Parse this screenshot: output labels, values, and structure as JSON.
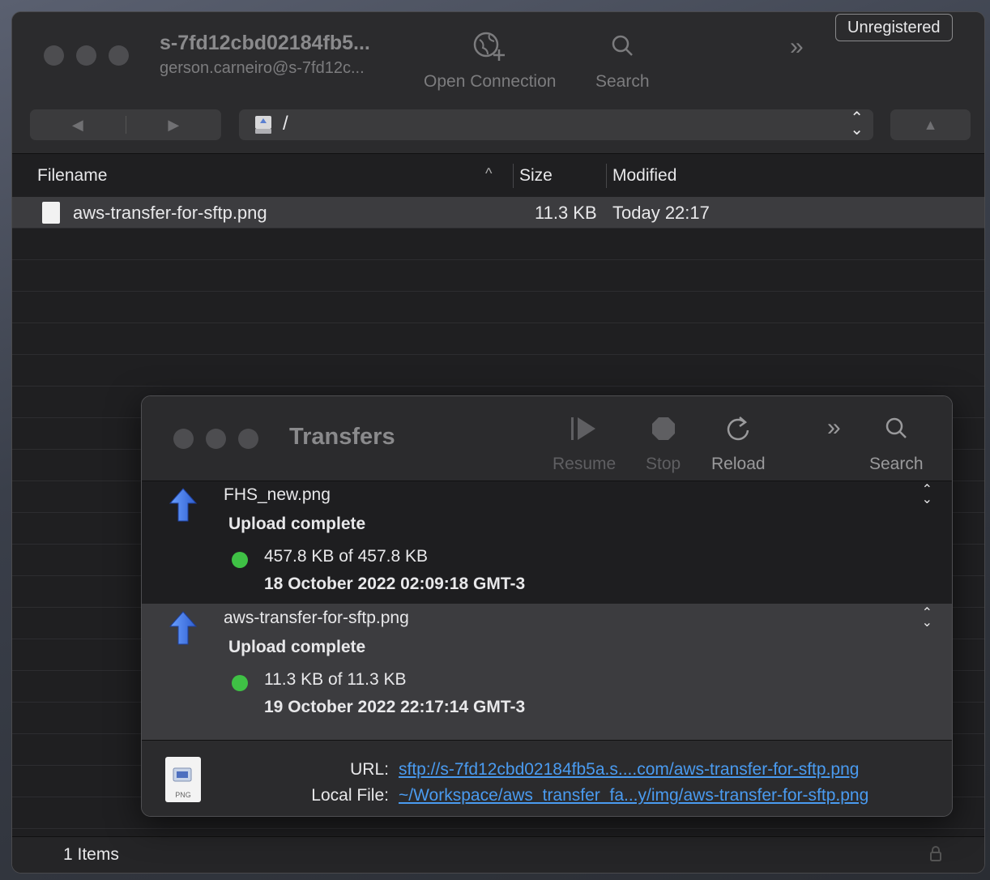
{
  "window": {
    "title": "s-7fd12cbd02184fb5...",
    "subtitle": "gerson.carneiro@s-7fd12c...",
    "unregistered_label": "Unregistered",
    "open_connection_label": "Open Connection",
    "search_label": "Search"
  },
  "nav": {
    "path": "/"
  },
  "columns": {
    "filename": "Filename",
    "size": "Size",
    "modified": "Modified"
  },
  "files": [
    {
      "name": "aws-transfer-for-sftp.png",
      "size": "11.3 KB",
      "modified": "Today 22:17"
    }
  ],
  "status": {
    "items": "1 Items"
  },
  "transfers": {
    "title": "Transfers",
    "resume_label": "Resume",
    "stop_label": "Stop",
    "reload_label": "Reload",
    "search_label": "Search",
    "items": [
      {
        "name": "FHS_new.png",
        "status": "Upload complete",
        "size": "457.8 KB of 457.8 KB",
        "date": "18 October 2022 02:09:18 GMT-3"
      },
      {
        "name": "aws-transfer-for-sftp.png",
        "status": "Upload complete",
        "size": "11.3 KB of 11.3 KB",
        "date": "19 October 2022 22:17:14 GMT-3"
      }
    ],
    "footer": {
      "url_label": "URL:",
      "url": "sftp://s-7fd12cbd02184fb5a.s....com/aws-transfer-for-sftp.png",
      "local_label": "Local File:",
      "local": "~/Workspace/aws_transfer_fa...y/img/aws-transfer-for-sftp.png",
      "file_type": "PNG"
    }
  },
  "colors": {
    "accent_link": "#4a9bf0",
    "success": "#3fc145"
  }
}
